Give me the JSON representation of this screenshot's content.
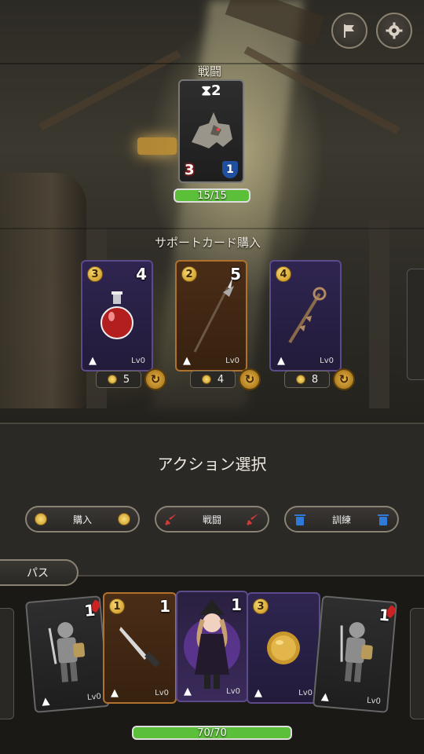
{
  "top_buttons": {
    "flag_icon": "flag-icon",
    "settings_icon": "gear-icon"
  },
  "battle": {
    "title": "戦闘",
    "enemy": {
      "timer": "2",
      "attack": "3",
      "defense": "1",
      "hp_text": "15/15",
      "hp_fraction": 1.0
    }
  },
  "shop": {
    "title": "サポートカード購入",
    "cards": [
      {
        "name": "potion",
        "type": "purple",
        "cost": "3",
        "attack": "4",
        "level": "Lv0",
        "price": "5"
      },
      {
        "name": "spear",
        "type": "brown",
        "cost": "2",
        "attack": "5",
        "level": "Lv0",
        "price": "4"
      },
      {
        "name": "staff",
        "type": "purple",
        "cost": "4",
        "attack": "",
        "level": "Lv0",
        "price": "8"
      }
    ]
  },
  "action": {
    "title": "アクション選択",
    "buttons": [
      {
        "label": "購入",
        "icon": "coin-icon",
        "color": "#e3b53a"
      },
      {
        "label": "戦闘",
        "icon": "sword-icon",
        "color": "#d23a3a"
      },
      {
        "label": "訓練",
        "icon": "trash-icon",
        "color": "#2f7ad8"
      }
    ],
    "pass_label": "パス"
  },
  "hand": {
    "cards": [
      {
        "name": "knight",
        "type": "dark",
        "cost": "",
        "attack": "1",
        "level": "Lv0"
      },
      {
        "name": "knife",
        "type": "brown",
        "cost": "1",
        "attack": "1",
        "level": "Lv0"
      },
      {
        "name": "witch",
        "type": "purple",
        "cost": "",
        "attack": "1",
        "level": "Lv0"
      },
      {
        "name": "gold-coin",
        "type": "purple",
        "cost": "3",
        "attack": "",
        "level": "Lv0"
      },
      {
        "name": "knight",
        "type": "dark",
        "cost": "",
        "attack": "1",
        "level": "Lv0"
      }
    ],
    "hp_text": "70/70",
    "hp_fraction": 1.0
  }
}
